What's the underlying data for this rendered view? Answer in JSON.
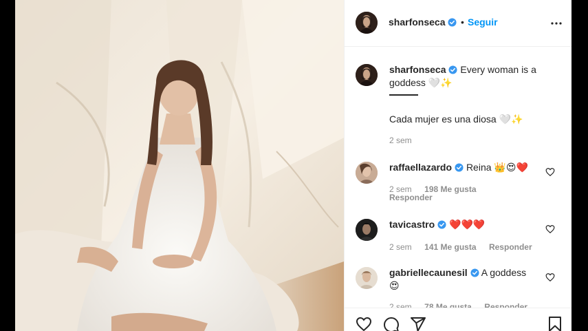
{
  "header": {
    "username": "sharfonseca",
    "separator": "•",
    "follow_label": "Seguir",
    "more_label": "More options"
  },
  "caption": {
    "username": "sharfonseca",
    "text_en": "Every woman is a",
    "text_en_2": "goddess",
    "text_en_emoji": "🤍✨",
    "text_es": "Cada mujer es una diosa",
    "text_es_emoji": "🤍✨",
    "time": "2 sem"
  },
  "comments": [
    {
      "username": "raffaellazardo",
      "text": "Reina",
      "emoji": "👑😍❤️",
      "time": "2 sem",
      "likes": "198 Me gusta",
      "reply": "Responder"
    },
    {
      "username": "tavicastro",
      "text": "",
      "emoji": "❤️❤️❤️",
      "time": "2 sem",
      "likes": "141 Me gusta",
      "reply": "Responder"
    },
    {
      "username": "gabriellecaunesil",
      "text": "A goddess",
      "emoji": "😍",
      "time": "2 sem",
      "likes": "78 Me gusta",
      "reply": "Responder"
    }
  ],
  "icons": {
    "like": "heart-icon",
    "comment": "comment-icon",
    "share": "paper-plane-icon",
    "save": "bookmark-icon",
    "verified": "verified-badge-icon"
  },
  "colors": {
    "accent": "#0095f6",
    "verified": "#3897f0",
    "text": "#262626",
    "muted": "#8e8e8e"
  }
}
